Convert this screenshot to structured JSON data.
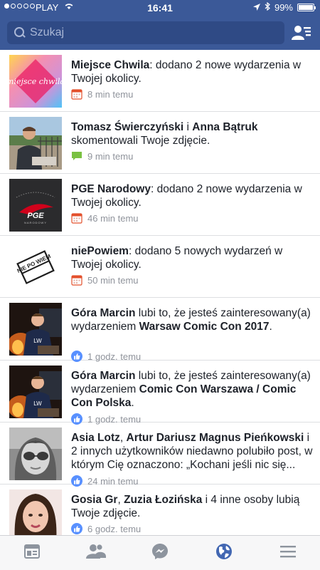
{
  "status_bar": {
    "carrier": "PLAY",
    "time": "16:41",
    "battery": "99%",
    "battery_level": 0.99
  },
  "search": {
    "placeholder": "Szukaj"
  },
  "notifications": [
    {
      "pre": "",
      "actor": "Miejsce Chwila",
      "mid": ": dodano 2 nowe wydarzenia w Twojej okolicy.",
      "target": "",
      "post": "",
      "time": "8 min temu",
      "icon": "calendar-icon"
    },
    {
      "pre": "",
      "actor": "Tomasz Świerczyński",
      "mid": " i ",
      "target": "Anna Bątruk",
      "post": " skomentowali Twoje zdjęcie.",
      "time": "9 min temu",
      "icon": "comment-icon"
    },
    {
      "pre": "",
      "actor": "PGE Narodowy",
      "mid": ": dodano 2 nowe wydarzenia w Twojej okolicy.",
      "target": "",
      "post": "",
      "time": "46 min temu",
      "icon": "calendar-icon"
    },
    {
      "pre": "",
      "actor": "niePowiem",
      "mid": ": dodano 5 nowych wydarzeń w Twojej okolicy.",
      "target": "",
      "post": "",
      "time": "50 min temu",
      "icon": "calendar-icon"
    },
    {
      "pre": "",
      "actor": "Góra Marcin",
      "mid": " lubi to, że jesteś zainteresowany(a) wydarzeniem ",
      "target": "Warsaw Comic Con 2017",
      "post": ".",
      "time": "1 godz. temu",
      "icon": "like-icon"
    },
    {
      "pre": "",
      "actor": "Góra Marcin",
      "mid": " lubi to, że jesteś zainteresowany(a) wydarzeniem ",
      "target": "Comic Con Warszawa / Comic Con Polska",
      "post": ".",
      "time": "1 godz. temu",
      "icon": "like-icon"
    },
    {
      "pre": "",
      "actor": "Asia Lotz",
      "mid": ", ",
      "target": "Artur Dariusz Magnus Pieńkowski",
      "post": " i 2 innych użytkowników niedawno polubiło post, w którym Cię oznaczono: „Kochani jeśli nic się...",
      "time": "24 min temu",
      "icon": "like-icon"
    },
    {
      "pre": "",
      "actor": "Gosia Gr",
      "mid": ", ",
      "target": "Zuzia Łozińska",
      "post": " i 4 inne osoby lubią Twoje zdjęcie.",
      "time": "6 godz. temu",
      "icon": "like-icon"
    }
  ],
  "thumb_texts": {
    "miejsce": "miejsce chwila",
    "pge": "PGE",
    "pge_sub": "NARODOWY",
    "niepowiem": "NIE PO WIEM"
  },
  "tabs": [
    {
      "name": "news-feed-icon",
      "active": false
    },
    {
      "name": "friend-requests-icon",
      "active": false
    },
    {
      "name": "messenger-icon",
      "active": false
    },
    {
      "name": "notifications-globe-icon",
      "active": true
    },
    {
      "name": "menu-icon",
      "active": false
    }
  ],
  "colors": {
    "brand": "#3b5998",
    "active_tab": "#4267b2",
    "meta_text": "#90949c"
  }
}
